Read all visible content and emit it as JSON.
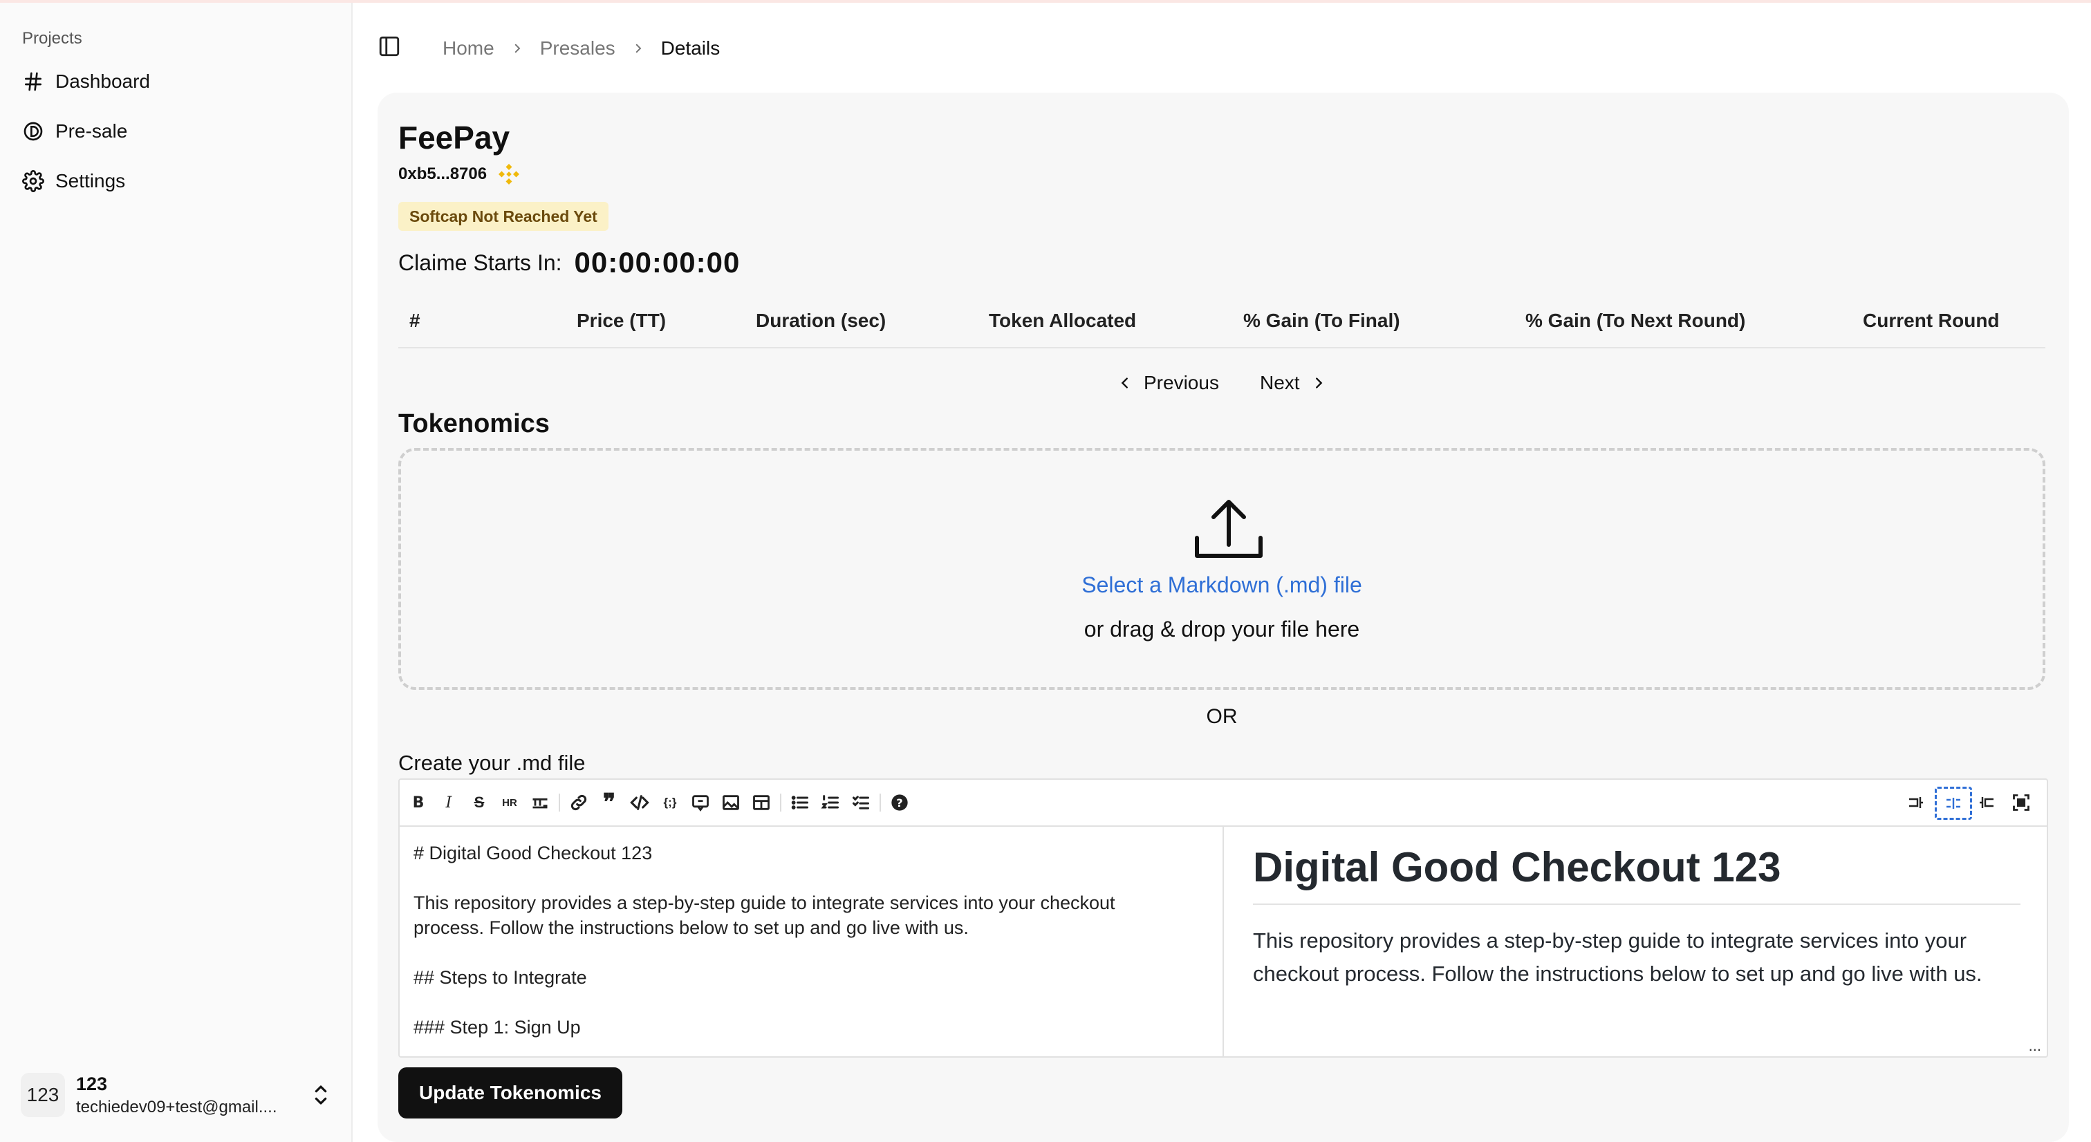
{
  "sidebar": {
    "section_heading": "Projects",
    "items": [
      {
        "label": "Dashboard",
        "icon": "hash-icon"
      },
      {
        "label": "Pre-sale",
        "icon": "coin-icon"
      },
      {
        "label": "Settings",
        "icon": "gear-icon"
      }
    ],
    "user": {
      "avatar_text": "123",
      "name": "123",
      "email": "techiedev09+test@gmail...."
    }
  },
  "breadcrumb": [
    "Home",
    "Presales",
    "Details"
  ],
  "project": {
    "name": "FeePay",
    "address": "0xb5...8706",
    "chain_icon": "bnb-icon",
    "status_badge": "Softcap Not Reached Yet",
    "claim_label": "Claime Starts In:",
    "claim_countdown": "00:00:00:00"
  },
  "rounds_table": {
    "columns": [
      "#",
      "Price (TT)",
      "Duration (sec)",
      "Token Allocated",
      "% Gain (To Final)",
      "% Gain (To Next Round)",
      "Current Round"
    ],
    "rows": []
  },
  "pagination": {
    "previous": "Previous",
    "next": "Next"
  },
  "tokenomics": {
    "title": "Tokenomics",
    "upload_link": "Select a Markdown (.md) file",
    "upload_sub": "or drag & drop your file here",
    "or_text": "OR",
    "create_label": "Create your .md file",
    "editor_source": "# Digital Good Checkout 123\n\nThis repository provides a step-by-step guide to integrate services into your checkout\nprocess. Follow the instructions below to set up and go live with us.\n\n## Steps to Integrate\n\n### Step 1: Sign Up",
    "preview_heading": "Digital Good Checkout 123",
    "preview_paragraph": "This repository provides a step-by-step guide to integrate services into your checkout process. Follow the instructions below to set up and go live with us.",
    "preview_more": "...",
    "update_button": "Update Tokenomics"
  },
  "colors": {
    "badge_bg": "#fbf1c7",
    "badge_text": "#6b4a0d",
    "link": "#2f6fd6",
    "bnb": "#f0b90b",
    "primary_button": "#111111"
  }
}
